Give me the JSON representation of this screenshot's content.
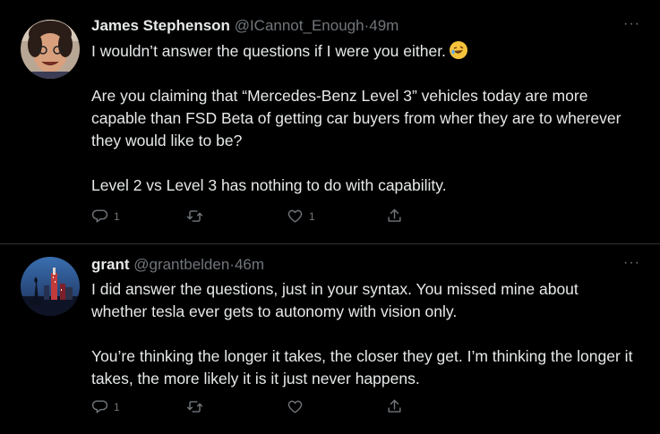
{
  "tweets": [
    {
      "display_name": "James Stephenson",
      "handle": "@ICannot_Enough",
      "separator": "·",
      "time": "49m",
      "paragraphs": [
        "I wouldn’t answer the questions if I were you either.",
        "Are you claiming that “Mercedes-Benz Level 3” vehicles today are more capable than FSD Beta of getting car buyers from wher they are to wherever they would like to be?",
        "Level 2 vs Level 3 has nothing to do with capability."
      ],
      "emoji": "rolling-on-the-floor-laughing",
      "reply_count": "1",
      "retweet_count": "",
      "like_count": "1",
      "more_label": "···"
    },
    {
      "display_name": "grant",
      "handle": "@grantbelden",
      "separator": "·",
      "time": "46m",
      "paragraphs": [
        "I did answer the questions, just in your syntax. You missed mine about whether tesla ever gets to autonomy with vision only.",
        "You’re thinking the longer it takes, the closer they get. I’m thinking the longer it takes, the more likely it is it just never happens."
      ],
      "reply_count": "1",
      "retweet_count": "",
      "like_count": "",
      "more_label": "···"
    }
  ],
  "icons": {
    "reply": "reply-icon",
    "retweet": "retweet-icon",
    "like": "heart-icon",
    "share": "share-icon",
    "more": "more-icon"
  },
  "colors": {
    "background": "#000000",
    "text": "#e7e9ea",
    "muted": "#71767b",
    "divider": "#2f3336"
  }
}
